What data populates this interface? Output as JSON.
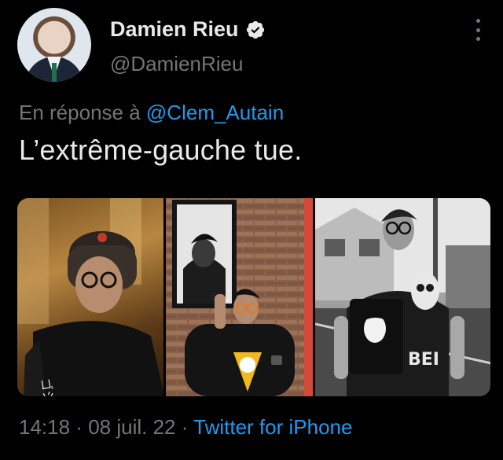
{
  "author": {
    "display_name": "Damien Rieu",
    "handle": "@DamienRieu",
    "verified": true
  },
  "reply": {
    "prefix": "En réponse à",
    "mention": "@Clem_Autain"
  },
  "tweet": {
    "text": "L’extrême-gauche tue."
  },
  "meta": {
    "time": "14:18",
    "separator1": " · ",
    "date": "08 juil. 22",
    "separator2": " · ",
    "source": "Twitter for iPhone"
  },
  "colors": {
    "background": "#000000",
    "text_primary": "#e7e9ea",
    "text_secondary": "#71767b",
    "link": "#1d9bf0"
  },
  "icons": [
    "verified-badge-icon",
    "more-options-icon"
  ],
  "media": [
    {
      "name": "photo-1"
    },
    {
      "name": "photo-2"
    },
    {
      "name": "photo-3"
    }
  ]
}
